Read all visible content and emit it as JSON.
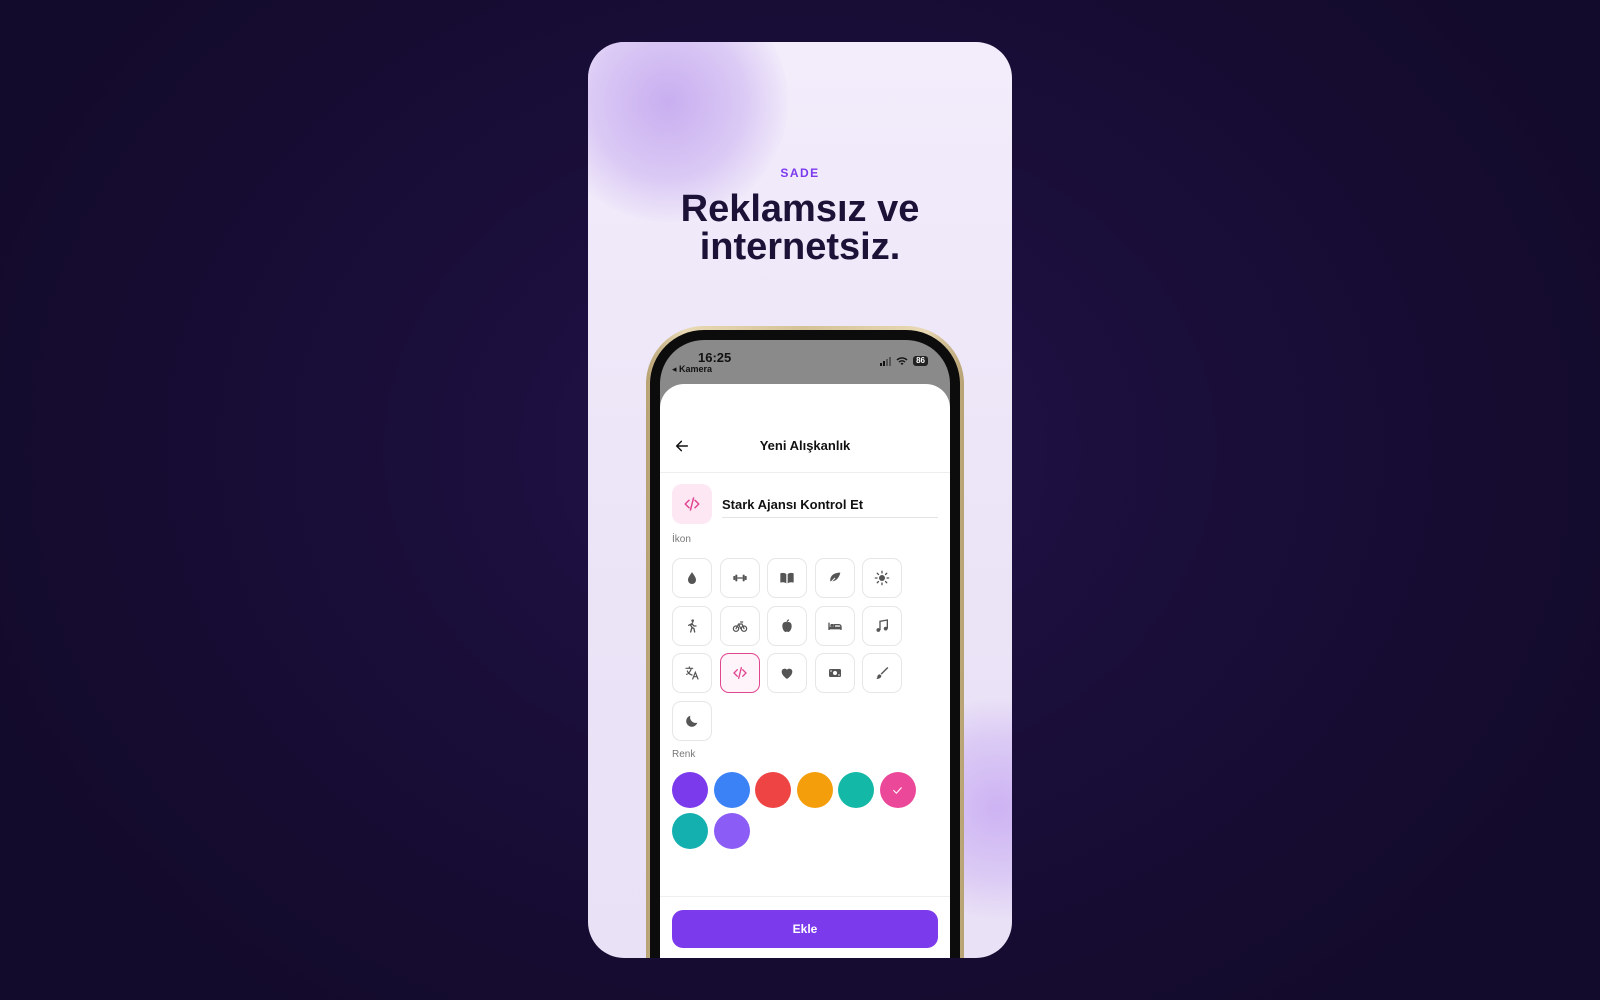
{
  "promo": {
    "eyebrow": "SADE",
    "headline_line1": "Reklamsız ve",
    "headline_line2": "internetsiz."
  },
  "status_bar": {
    "time": "16:25",
    "back_app": "◂ Kamera",
    "battery": "86"
  },
  "screen": {
    "title": "Yeni Alışkanlık",
    "habit_name": "Stark Ajansı Kontrol Et",
    "icon_section_label": "İkon",
    "color_section_label": "Renk",
    "add_button_label": "Ekle"
  },
  "icons": [
    {
      "name": "water-drop-icon",
      "selected": false
    },
    {
      "name": "dumbbell-icon",
      "selected": false
    },
    {
      "name": "book-icon",
      "selected": false
    },
    {
      "name": "leaf-icon",
      "selected": false
    },
    {
      "name": "sun-icon",
      "selected": false
    },
    {
      "name": "walking-icon",
      "selected": false
    },
    {
      "name": "bicycle-icon",
      "selected": false
    },
    {
      "name": "apple-icon",
      "selected": false
    },
    {
      "name": "bed-icon",
      "selected": false
    },
    {
      "name": "music-note-icon",
      "selected": false
    },
    {
      "name": "translate-icon",
      "selected": false
    },
    {
      "name": "code-icon",
      "selected": true
    },
    {
      "name": "heart-icon",
      "selected": false
    },
    {
      "name": "money-icon",
      "selected": false
    },
    {
      "name": "paintbrush-icon",
      "selected": false
    },
    {
      "name": "moon-icon",
      "selected": false
    }
  ],
  "colors": [
    {
      "hex": "#7c3aed",
      "selected": false
    },
    {
      "hex": "#3b82f6",
      "selected": false
    },
    {
      "hex": "#ef4444",
      "selected": false
    },
    {
      "hex": "#f59e0b",
      "selected": false
    },
    {
      "hex": "#14b8a6",
      "selected": false
    },
    {
      "hex": "#ec4899",
      "selected": true
    },
    {
      "hex": "#14b0b0",
      "selected": false
    },
    {
      "hex": "#8b5cf6",
      "selected": false
    }
  ],
  "theme": {
    "accent": "#7c3aed",
    "selected_icon_color": "#e0458f",
    "icon_gray": "#555555"
  }
}
